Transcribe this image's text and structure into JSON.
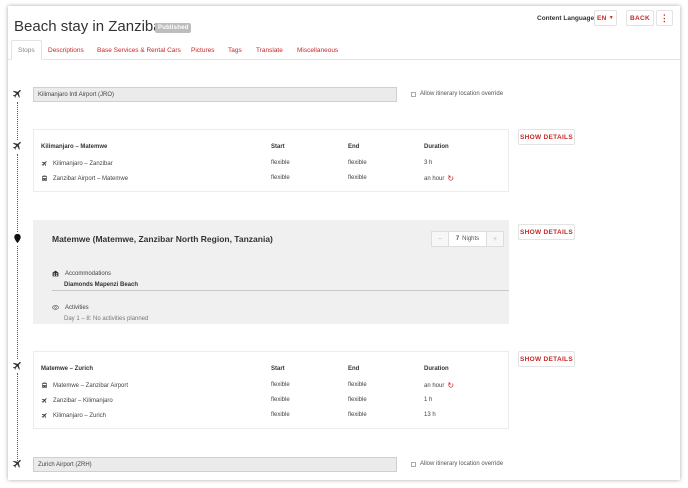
{
  "header": {
    "title": "Beach stay in Zanzibar",
    "badge": "Published",
    "content_language_label": "Content Language",
    "language_value": "EN",
    "back_label": "BACK",
    "more_icon": "more-vertical-icon"
  },
  "tabs": [
    {
      "label": "Stops",
      "active": true
    },
    {
      "label": "Descriptions"
    },
    {
      "label": "Base Services & Rental Cars"
    },
    {
      "label": "Pictures"
    },
    {
      "label": "Tags"
    },
    {
      "label": "Translate"
    },
    {
      "label": "Miscellaneous"
    }
  ],
  "start_location": {
    "value": "Kilimanjaro Intl Airport (JRO)",
    "override_label": "Allow itinerary location override"
  },
  "transfer1": {
    "title": "Kilimanjaro  – Matemwe",
    "columns": [
      "Start",
      "End",
      "Duration"
    ],
    "show_details": "SHOW DETAILS",
    "rows": [
      {
        "icon": "plane-icon",
        "route": "Kilimanjaro  – Zanzibar",
        "start": "flexible",
        "end": "flexible",
        "duration": "3 h"
      },
      {
        "icon": "bus-icon",
        "route": "Zanzibar Airport  – Matemwe",
        "start": "flexible",
        "end": "flexible",
        "duration": "an hour"
      }
    ]
  },
  "stay": {
    "title": "Matemwe (Matemwe, Zanzibar North Region, Tanzania)",
    "nights_value": "7",
    "nights_label": "Nights",
    "show_details": "SHOW DETAILS",
    "accommodations_label": "Accommodations",
    "accommodation_name": "Diamonds Mapenzi Beach",
    "activities_label": "Activities",
    "activities_value": "Day 1 – 8: No activities planned"
  },
  "transfer2": {
    "title": "Matemwe  – Zurich",
    "columns": [
      "Start",
      "End",
      "Duration"
    ],
    "show_details": "SHOW DETAILS",
    "rows": [
      {
        "icon": "bus-icon",
        "route": "Matemwe  – Zanzibar Airport",
        "start": "flexible",
        "end": "flexible",
        "duration": "an hour"
      },
      {
        "icon": "plane-icon",
        "route": "Zanzibar  – Kilimanjaro",
        "start": "flexible",
        "end": "flexible",
        "duration": "1 h"
      },
      {
        "icon": "plane-icon",
        "route": "Kilimanjaro  – Zurich",
        "start": "flexible",
        "end": "flexible",
        "duration": "13 h"
      }
    ]
  },
  "end_location": {
    "value": "Zurich Airport (ZRH)",
    "override_label": "Allow itinerary location override"
  },
  "colors": {
    "accent": "#c62828",
    "stay_bg": "#f0f0f0",
    "badge_bg": "#bdbdbd"
  }
}
